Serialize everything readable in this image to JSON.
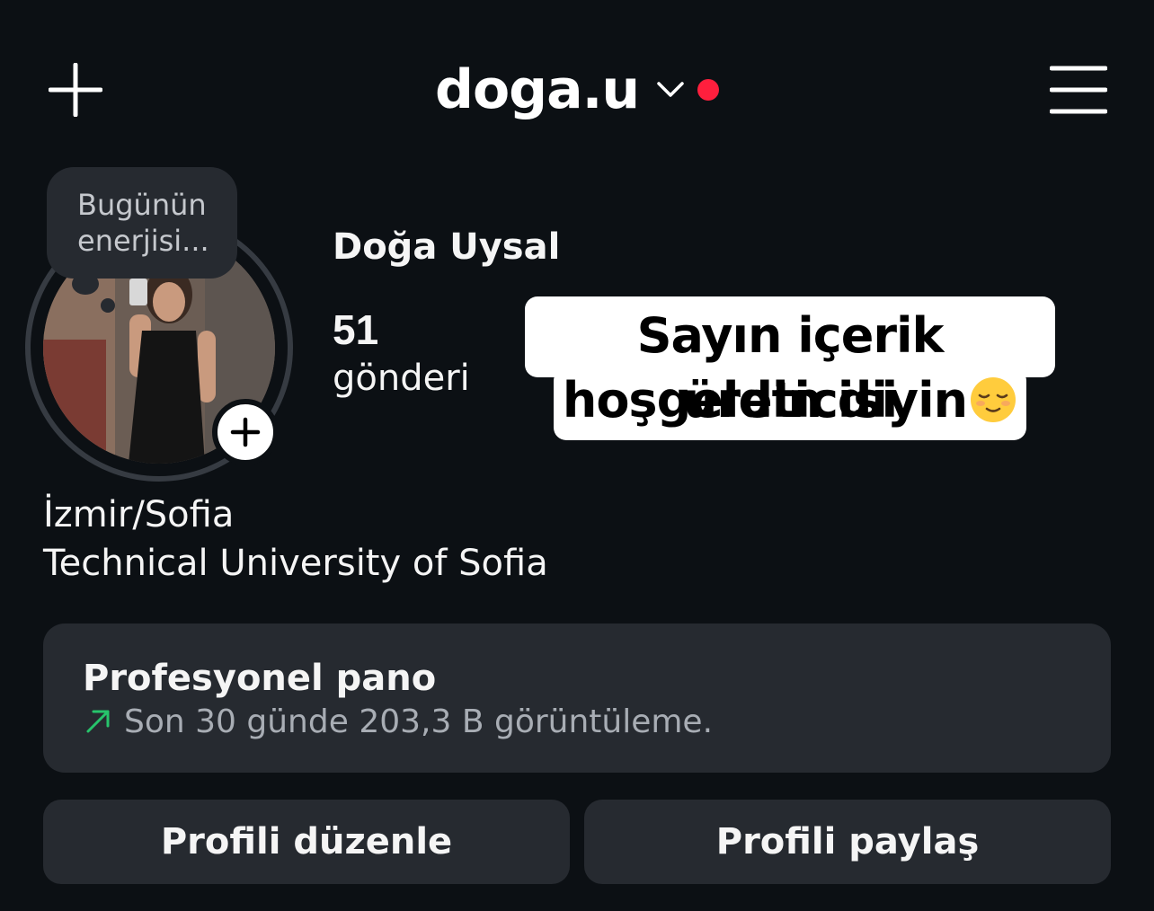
{
  "header": {
    "username": "doga.u",
    "add_icon": "plus-icon",
    "dropdown_icon": "chevron-down-icon",
    "notification_dot_color": "#ff1f3d",
    "menu_icon": "hamburger-menu-icon"
  },
  "profile": {
    "note": "Bugünün enerjisi...",
    "full_name": "Doğa Uysal",
    "posts_count": "51",
    "posts_label": "gönderi",
    "story_add_icon": "plus-icon",
    "bio": [
      "İzmir/Sofia",
      "Technical University of Sofia"
    ]
  },
  "overlay_caption": {
    "line1": "Sayın içerik üreticisi",
    "line2": "hoşgeldin diyin",
    "emoji": "relieved-face-emoji"
  },
  "dashboard": {
    "title": "Profesyonel pano",
    "stat": "Son 30 günde 203,3 B görüntüleme.",
    "trend_icon": "arrow-up-right-icon",
    "trend_color": "#27c46b"
  },
  "actions": {
    "edit_label": "Profili düzenle",
    "share_label": "Profili paylaş"
  },
  "colors": {
    "background": "#0c1014",
    "card": "#262a30"
  }
}
